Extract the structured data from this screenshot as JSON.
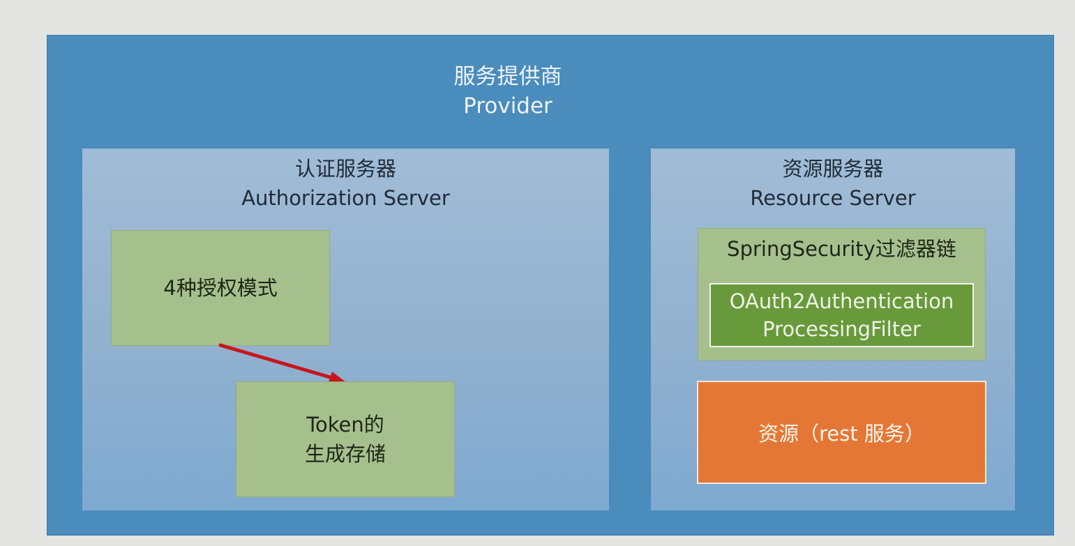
{
  "provider": {
    "title_cn": "服务提供商",
    "title_en": "Provider"
  },
  "authorization_server": {
    "title_cn": "认证服务器",
    "title_en": "Authorization Server",
    "grant_modes_label": "4种授权模式",
    "token_label_line1": "Token的",
    "token_label_line2": "生成存储"
  },
  "resource_server": {
    "title_cn": "资源服务器",
    "title_en": "Resource Server",
    "filter_chain_label": "SpringSecurity过滤器链",
    "filter_line1": "OAuth2Authentication",
    "filter_line2": "ProcessingFilter",
    "resource_label": "资源（rest 服务）"
  },
  "colors": {
    "provider_bg": "#4a8dbd",
    "panel_bg": "#91b1cf",
    "green_box": "#a5c08c",
    "filter_box": "#689a3c",
    "resource_box": "#e47735",
    "arrow": "#c8161d"
  }
}
